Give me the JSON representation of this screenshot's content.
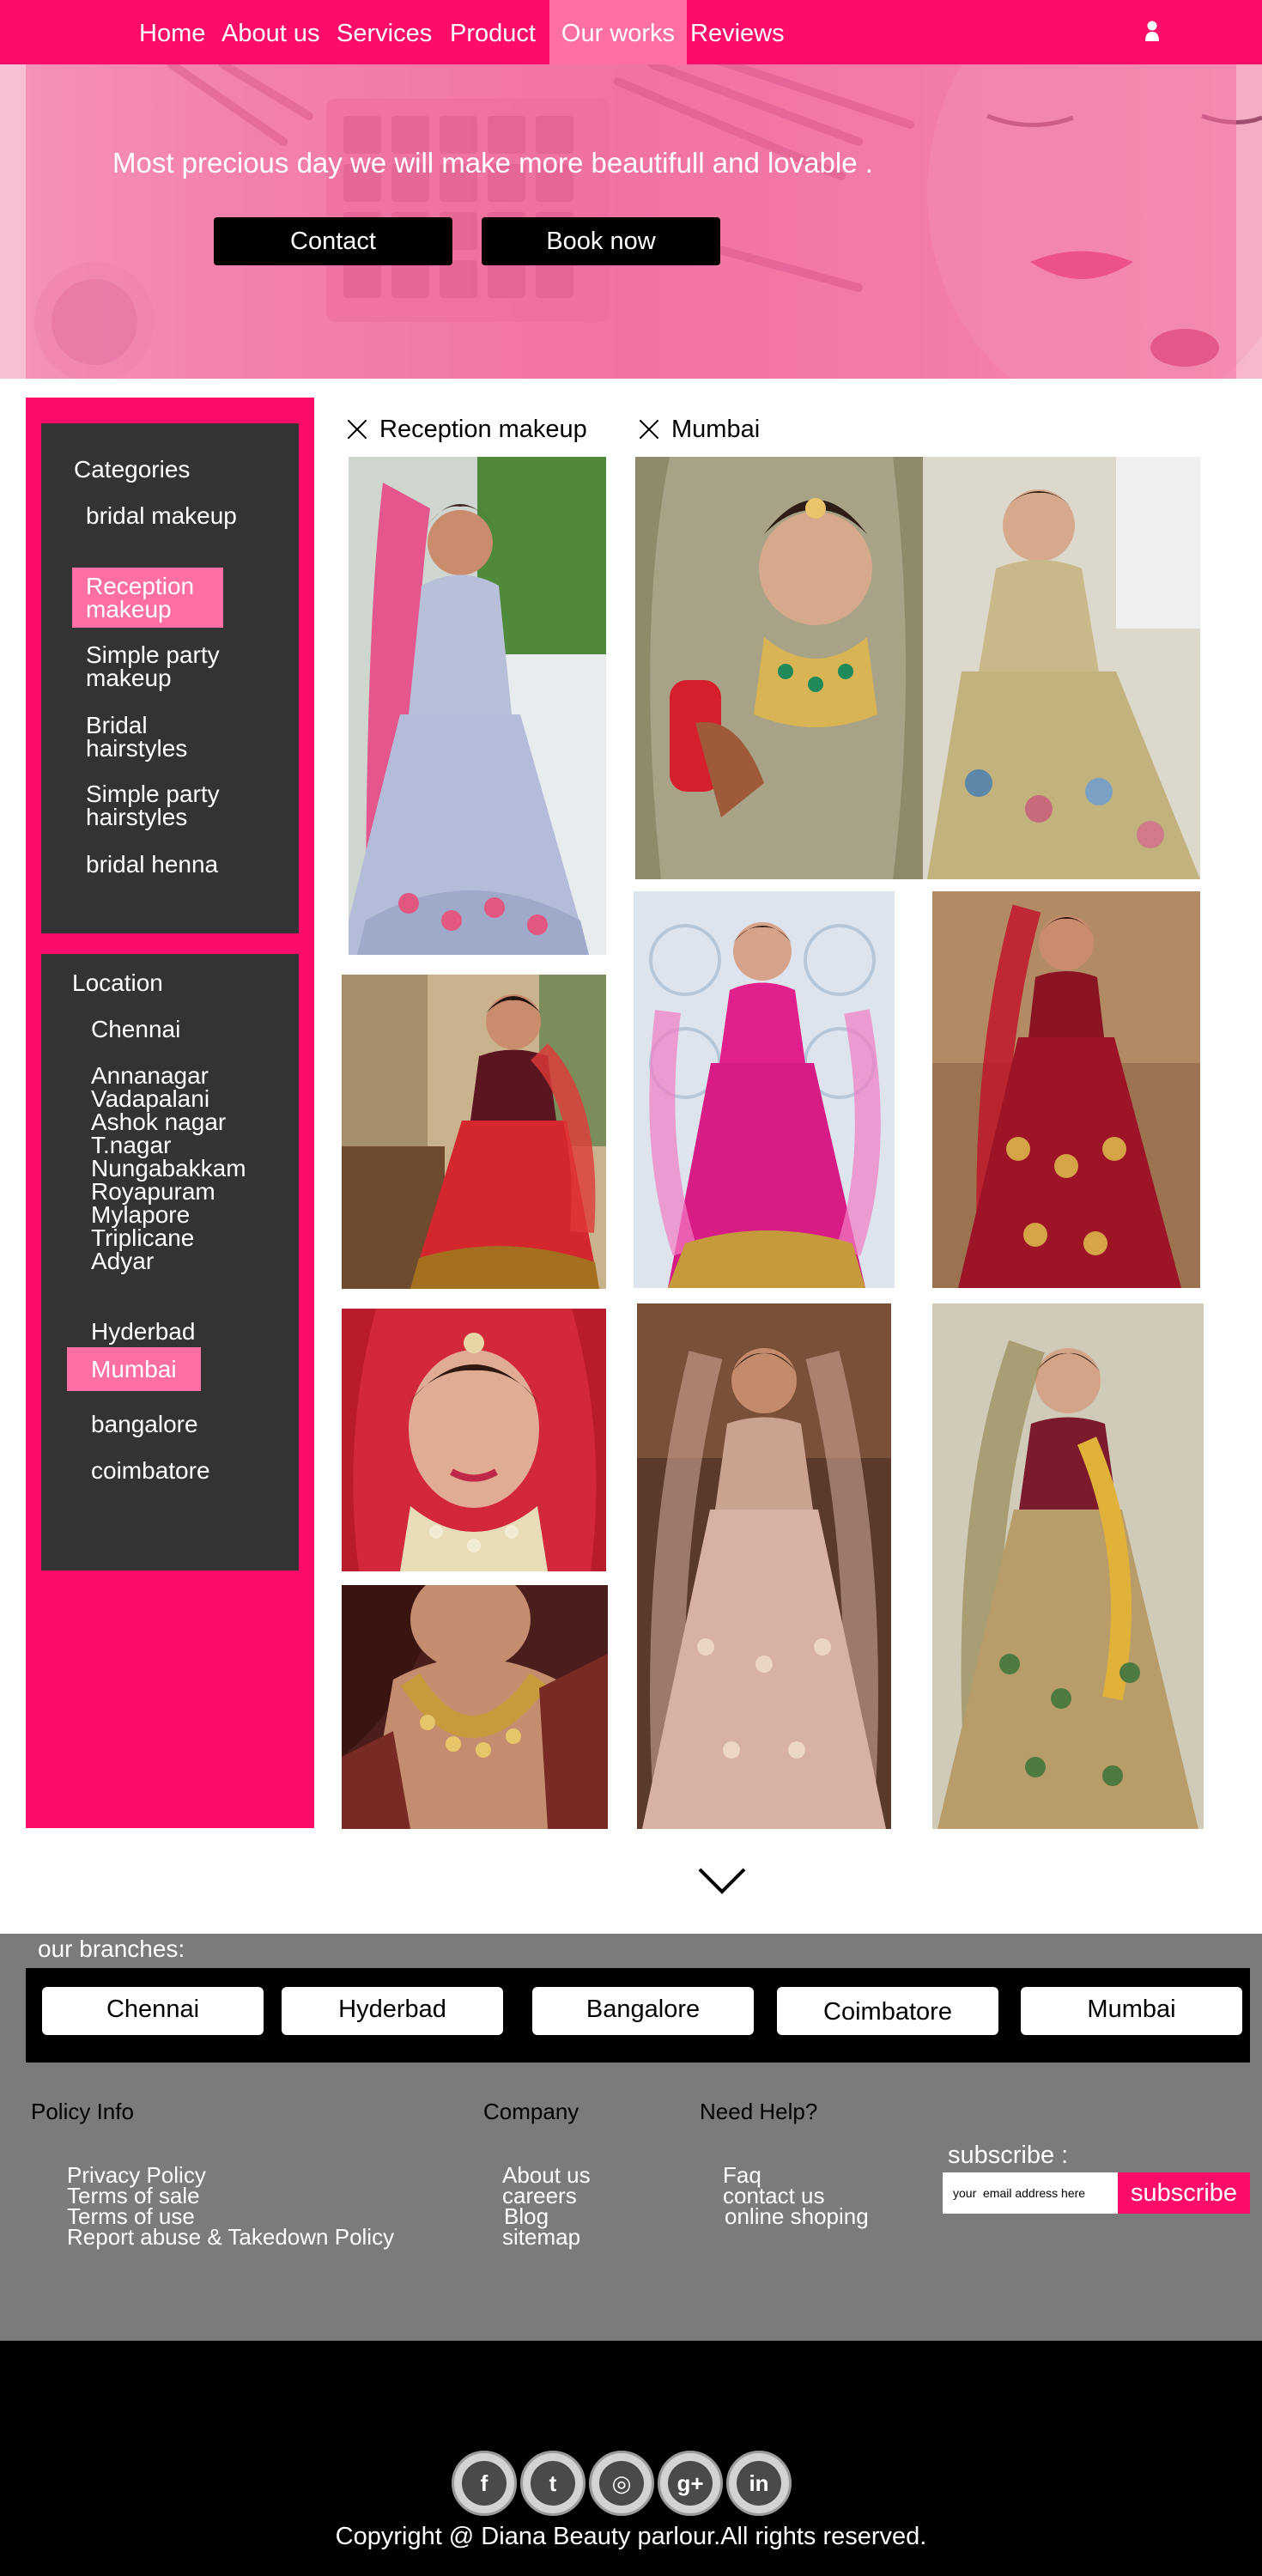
{
  "nav": {
    "items": [
      {
        "label": "Home"
      },
      {
        "label": "About us"
      },
      {
        "label": "Services"
      },
      {
        "label": "Product"
      },
      {
        "label": "Our works",
        "active": true
      },
      {
        "label": "Reviews"
      }
    ],
    "user_icon": "user-icon",
    "brand_color": "#fe0c6a",
    "active_color": "#ff6fa3"
  },
  "hero": {
    "title": "Most precious day we will  make more  beautifull and lovable .",
    "buttons": {
      "contact": "Contact",
      "book": "Book now"
    }
  },
  "sidebar": {
    "categories": {
      "title": "Categories",
      "items": [
        {
          "label": "bridal makeup"
        },
        {
          "label": "Reception makeup",
          "active": true
        },
        {
          "label": "Simple party makeup"
        },
        {
          "label": "Bridal hairstyles"
        },
        {
          "label": "Simple party hairstyles"
        },
        {
          "label": "bridal henna"
        }
      ]
    },
    "location": {
      "title": "Location",
      "items": [
        {
          "label": "Chennai"
        },
        {
          "label": "Annanagar"
        },
        {
          "label": "Vadapalani"
        },
        {
          "label": "Ashok nagar"
        },
        {
          "label": "T.nagar"
        },
        {
          "label": "Nungabakkam"
        },
        {
          "label": "Royapuram"
        },
        {
          "label": "Mylapore"
        },
        {
          "label": "Triplicane"
        },
        {
          "label": "Adyar"
        },
        {
          "label": "Hyderbad"
        },
        {
          "label": "Mumbai",
          "active": true
        },
        {
          "label": "bangalore"
        },
        {
          "label": "coimbatore"
        }
      ]
    }
  },
  "filters": {
    "chips": [
      {
        "label": "Reception makeup",
        "icon": "close-icon"
      },
      {
        "label": "Mumbai",
        "icon": "close-icon"
      }
    ]
  },
  "gallery": {
    "photos": [
      {
        "name": "bride-lilac-lehenga"
      },
      {
        "name": "bride-jewelled-closeup"
      },
      {
        "name": "bride-gold-lehenga-seated"
      },
      {
        "name": "bride-red-lehenga"
      },
      {
        "name": "bride-pink-lehenga"
      },
      {
        "name": "bride-maroon-lehenga"
      },
      {
        "name": "bride-portrait-red-dupatta"
      },
      {
        "name": "bride-rose-gold-lehenga"
      },
      {
        "name": "bride-olive-lehenga"
      },
      {
        "name": "bride-necklace-closeup"
      }
    ],
    "more_icon": "chevron-down-icon"
  },
  "branches": {
    "title": "our branches:",
    "items": [
      "Chennai",
      "Hyderbad",
      "Bangalore",
      "Coimbatore",
      "Mumbai"
    ]
  },
  "footer": {
    "policy": {
      "title": "Policy Info",
      "links": [
        "Privacy Policy",
        "Terms of sale",
        "Terms of use",
        "Report abuse & Takedown Policy"
      ]
    },
    "company": {
      "title": "Company",
      "links": [
        "About us",
        "careers",
        "Blog",
        "sitemap"
      ]
    },
    "help": {
      "title": "Need Help?",
      "links": [
        "Faq",
        "contact us",
        "online shoping"
      ]
    },
    "subscribe": {
      "label": "subscribe :",
      "placeholder": "your  email address here",
      "button": "subscribe"
    },
    "social": [
      {
        "icon": "facebook-icon",
        "glyph": "f"
      },
      {
        "icon": "twitter-icon",
        "glyph": "t"
      },
      {
        "icon": "instagram-icon",
        "glyph": "◎"
      },
      {
        "icon": "google-plus-icon",
        "glyph": "g+"
      },
      {
        "icon": "linkedin-icon",
        "glyph": "in"
      }
    ],
    "copyright": "Copyright @ Diana Beauty parlour.All rights reserved."
  }
}
